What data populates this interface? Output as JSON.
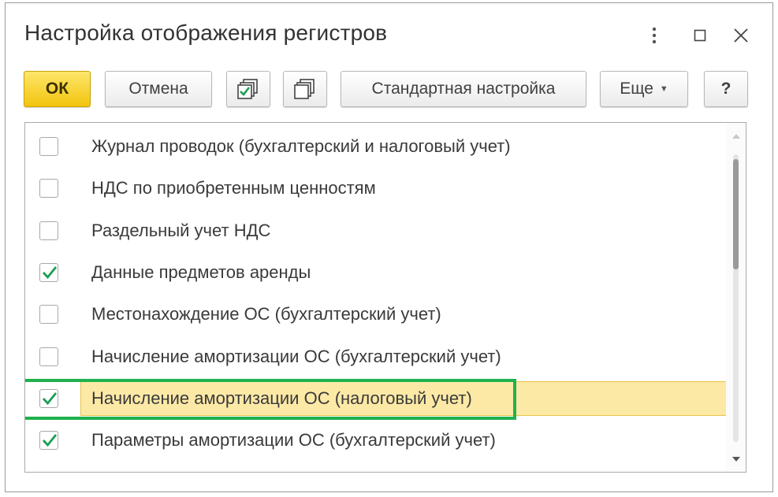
{
  "window": {
    "title": "Настройка отображения регистров"
  },
  "toolbar": {
    "ok_label": "ОК",
    "cancel_label": "Отмена",
    "standard_label": "Стандартная настройка",
    "more_label": "Еще",
    "help_label": "?"
  },
  "list": {
    "items": [
      {
        "label": "Журнал проводок (бухгалтерский и налоговый учет)",
        "checked": false
      },
      {
        "label": "НДС по приобретенным ценностям",
        "checked": false
      },
      {
        "label": "Раздельный учет НДС",
        "checked": false
      },
      {
        "label": "Данные предметов аренды",
        "checked": true
      },
      {
        "label": "Местонахождение ОС (бухгалтерский учет)",
        "checked": false
      },
      {
        "label": "Начисление амортизации ОС (бухгалтерский учет)",
        "checked": false
      },
      {
        "label": "Начисление амортизации ОС (налоговый учет)",
        "checked": true,
        "selected": true
      },
      {
        "label": "Параметры амортизации ОС (бухгалтерский учет)",
        "checked": true
      }
    ]
  },
  "colors": {
    "ok_button": "#f5cb1a",
    "selection": "#fde9a6",
    "highlight_frame": "#1fb14d",
    "checkmark": "#1a9e55"
  }
}
